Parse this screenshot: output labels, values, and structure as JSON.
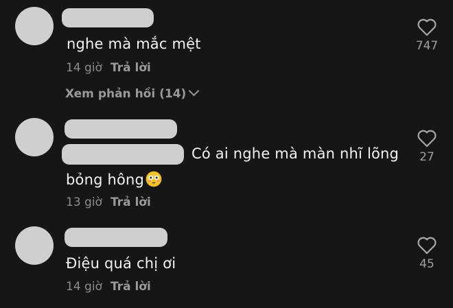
{
  "comments": [
    {
      "text": "nghe mà mắc mệt",
      "time": "14 giờ",
      "reply_label": "Trả lời",
      "view_replies": "Xem phản hồi (14)",
      "likes": "747",
      "icon": "heart-outline-icon"
    },
    {
      "text_line1": "Có ai nghe mà màn nhĩ lõng",
      "text_line2": "bỏng hông",
      "emoji": "flushed-face-emoji",
      "time": "13 giờ",
      "reply_label": "Trả lời",
      "likes": "27",
      "icon": "heart-outline-icon"
    },
    {
      "text": "Điệu quá chị ơi",
      "time": "14 giờ",
      "reply_label": "Trả lời",
      "likes": "45",
      "icon": "heart-outline-icon"
    }
  ],
  "colors": {
    "background": "#161616",
    "redaction": "#cfcfcf",
    "text": "#f4f4f4",
    "muted": "#8e8e8e"
  }
}
